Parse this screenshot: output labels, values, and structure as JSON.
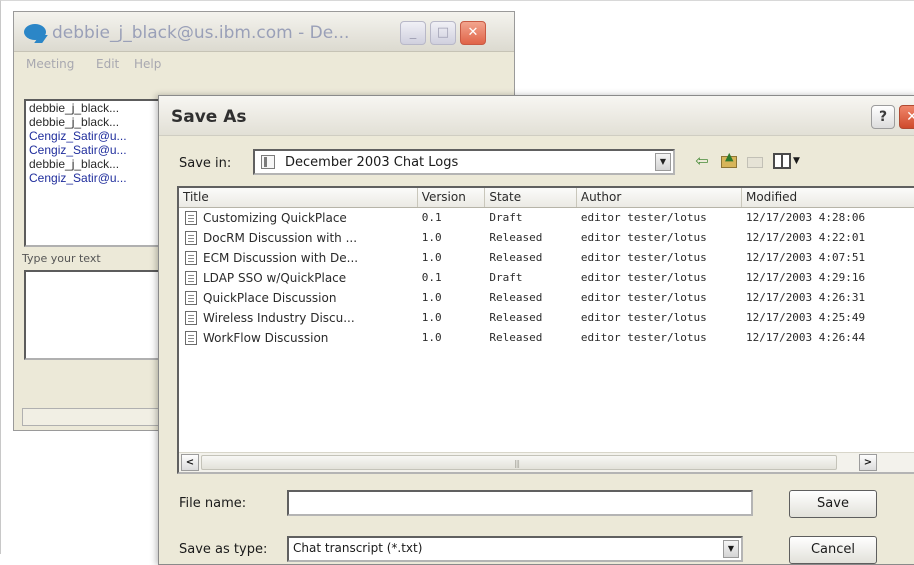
{
  "chat_window": {
    "title": "debbie_j_black@us.ibm.com - De...",
    "menu": [
      "Meeting",
      "Edit",
      "Help"
    ],
    "participants": [
      "debbie_j_black...",
      "debbie_j_black...",
      "Cengiz_Satir@u...",
      "Cengiz_Satir@u...",
      "debbie_j_black...",
      "Cengiz_Satir@u..."
    ],
    "type_label": "Type your text",
    "buttons": {
      "minimize": "_",
      "maximize": "□",
      "close": "✕"
    }
  },
  "dialog": {
    "title": "Save As",
    "help": "?",
    "close": "✕",
    "save_in_label": "Save in:",
    "save_in_value": "December 2003 Chat Logs",
    "columns": [
      "Title",
      "Version",
      "State",
      "Author",
      "Modified"
    ],
    "rows": [
      [
        "Customizing QuickPlace",
        "0.1",
        "Draft",
        "editor tester/lotus",
        "12/17/2003 4:28:06"
      ],
      [
        "DocRM Discussion with ...",
        "1.0",
        "Released",
        "editor tester/lotus",
        "12/17/2003 4:22:01"
      ],
      [
        "ECM Discussion with De...",
        "1.0",
        "Released",
        "editor tester/lotus",
        "12/17/2003 4:07:51"
      ],
      [
        "LDAP SSO w/QuickPlace",
        "0.1",
        "Draft",
        "editor tester/lotus",
        "12/17/2003 4:29:16"
      ],
      [
        "QuickPlace Discussion",
        "1.0",
        "Released",
        "editor tester/lotus",
        "12/17/2003 4:26:31"
      ],
      [
        "Wireless Industry Discu...",
        "1.0",
        "Released",
        "editor tester/lotus",
        "12/17/2003 4:25:49"
      ],
      [
        "WorkFlow Discussion",
        "1.0",
        "Released",
        "editor tester/lotus",
        "12/17/2003 4:26:44"
      ]
    ],
    "scroll": {
      "left": "<",
      "right": ">",
      "grip": "|||"
    },
    "file_name_label": "File name:",
    "file_name_value": "",
    "save_type_label": "Save as type:",
    "save_type_value": "Chat transcript (*.txt)",
    "save_button": "Save",
    "cancel_button": "Cancel"
  },
  "icons": {
    "app": "chat-bubble-icon",
    "back": "back-arrow-icon",
    "up": "up-folder-icon",
    "new_folder": "new-folder-icon",
    "views": "view-menu-icon",
    "file": "document-icon"
  },
  "colors": {
    "dialog_bg": "#ece9d8",
    "close_red": "#d9583b",
    "participant_blue": "#1f2d9c",
    "back_arrow_green": "#4a8c3a"
  }
}
